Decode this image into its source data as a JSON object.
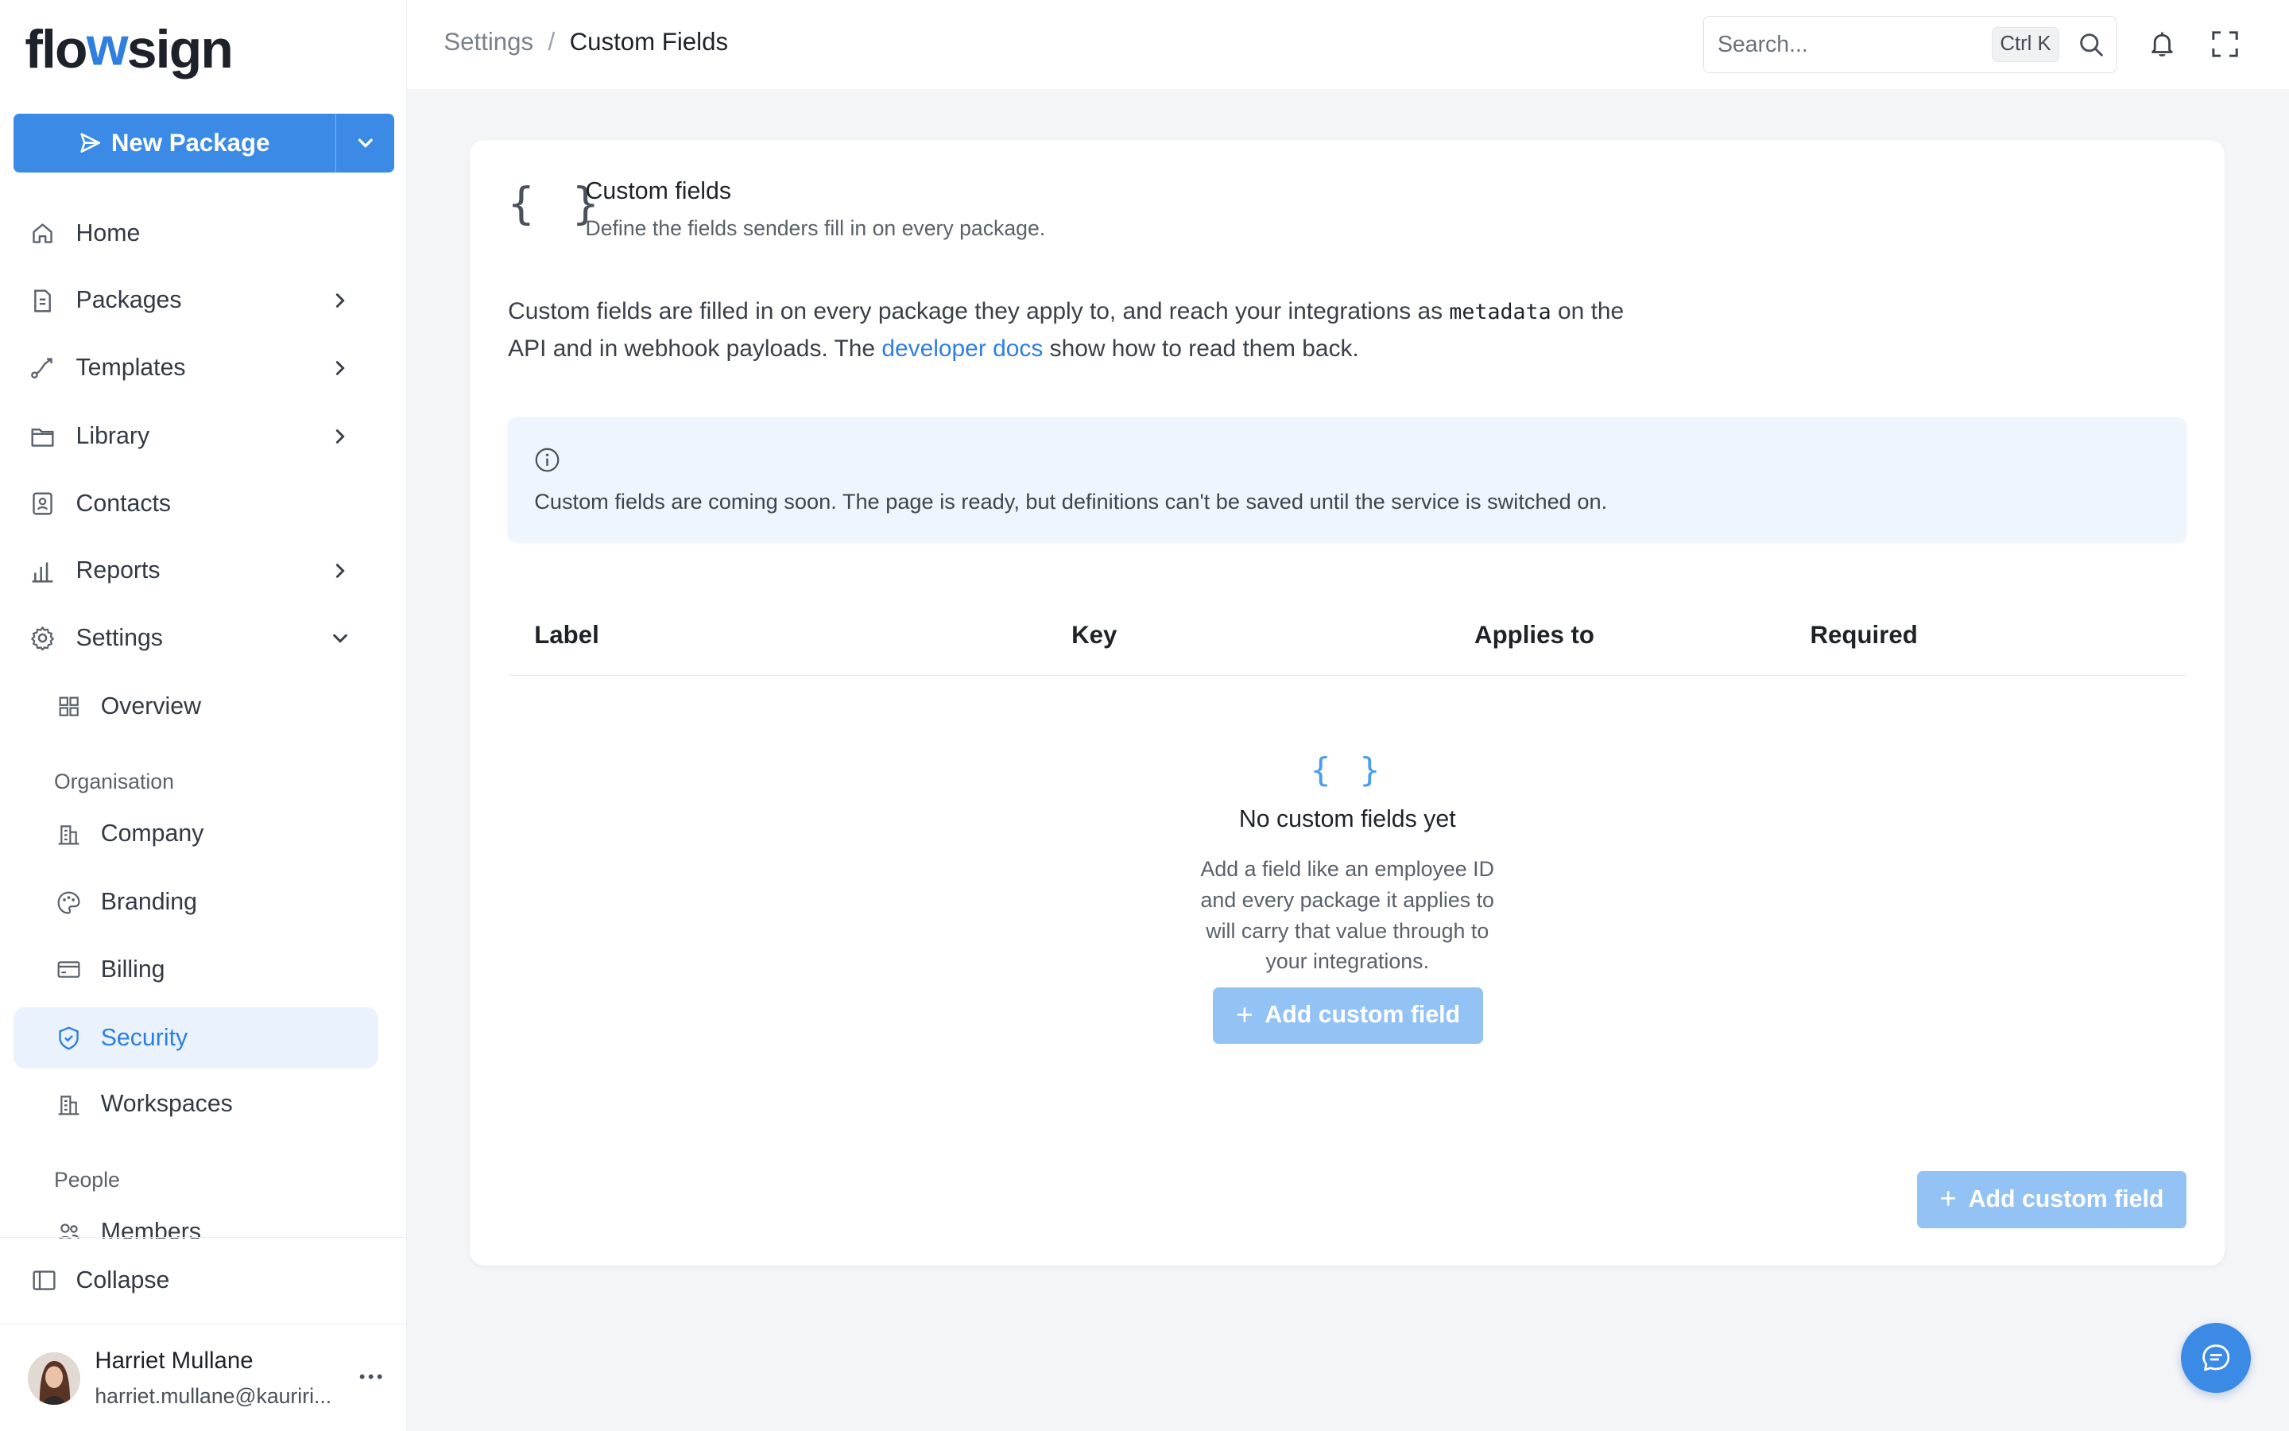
{
  "brand": {
    "logo_left": "flo",
    "logo_mid": "w",
    "logo_right": "sign"
  },
  "sidebar": {
    "new_package_label": "New Package",
    "items": [
      {
        "label": "Home"
      },
      {
        "label": "Packages"
      },
      {
        "label": "Templates"
      },
      {
        "label": "Library"
      },
      {
        "label": "Contacts"
      },
      {
        "label": "Reports"
      },
      {
        "label": "Settings"
      }
    ],
    "settings_sub": {
      "overview": "Overview",
      "group_org": "Organisation",
      "company": "Company",
      "branding": "Branding",
      "billing": "Billing",
      "security": "Security",
      "workspaces": "Workspaces",
      "group_people": "People",
      "members": "Members"
    },
    "collapse_label": "Collapse",
    "active_item": "Security"
  },
  "user": {
    "name": "Harriet Mullane",
    "email": "harriet.mullane@kauriri..."
  },
  "header": {
    "breadcrumb": {
      "parent": "Settings",
      "separator": "/",
      "current": "Custom Fields"
    },
    "search": {
      "placeholder": "Search...",
      "shortcut": "Ctrl K"
    }
  },
  "card": {
    "icon_glyph": "{ }",
    "title": "Custom fields",
    "subtitle": "Define the fields senders fill in on every package.",
    "desc_part1": "Custom fields are filled in on every package they apply to, and reach your integrations as ",
    "desc_code": "metadata",
    "desc_part2": " on the API and in webhook payloads. The ",
    "desc_link": "developer docs",
    "desc_part3": " show how to read them back.",
    "notice": "Custom fields are coming soon. The page is ready, but definitions can't be saved until the service is switched on.",
    "table": {
      "columns": [
        "Label",
        "Key",
        "Applies to",
        "Required"
      ]
    },
    "empty": {
      "icon_glyph": "{ }",
      "title": "No custom fields yet",
      "text": "Add a field like an employee ID and every package it applies to will carry that value through to your integrations."
    },
    "add_button": "Add custom field",
    "add_button_plus": "+"
  },
  "colors": {
    "accent": "#3b8ae6",
    "accent_light": "#93c2f5",
    "active_bg": "#e9f2fd",
    "notice_bg": "#eef5fd"
  }
}
